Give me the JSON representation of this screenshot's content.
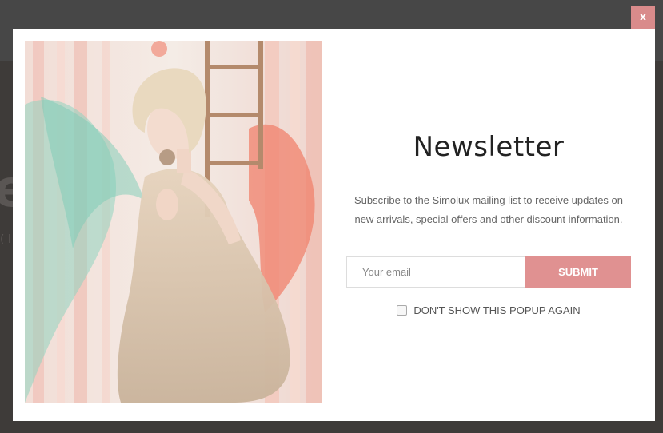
{
  "backdrop": {
    "ghost_text": "e",
    "ghost_text_small": "( l"
  },
  "popup": {
    "close_label": "x",
    "title": "Newsletter",
    "description": "Subscribe to the Simolux mailing list to receive updates on new arrivals, special offers and other discount information.",
    "email_placeholder": "Your email",
    "email_value": "",
    "submit_label": "SUBMIT",
    "dont_show_label": "DON'T SHOW THIS POPUP AGAIN",
    "dont_show_checked": false
  },
  "colors": {
    "accent": "#e09191",
    "close_bg": "#d98b8b",
    "overlay": "#3e3b39"
  }
}
